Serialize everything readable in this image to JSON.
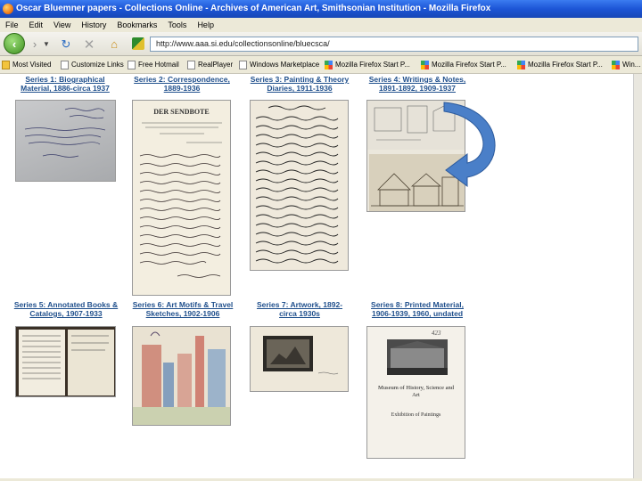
{
  "window": {
    "title": "Oscar Bluemner papers - Collections Online - Archives of American Art, Smithsonian Institution - Mozilla Firefox"
  },
  "menu": [
    "File",
    "Edit",
    "View",
    "History",
    "Bookmarks",
    "Tools",
    "Help"
  ],
  "nav": {
    "url": "http://www.aaa.si.edu/collectionsonline/bluecsca/"
  },
  "bookmarks": [
    "Most Visited",
    "Customize Links",
    "Free Hotmail",
    "RealPlayer",
    "Windows Marketplace",
    "Mozilla Firefox Start P...",
    "Mozilla Firefox Start P...",
    "Mozilla Firefox Start P...",
    "Win..."
  ],
  "series": [
    {
      "title": "Series 1: Biographical Material, 1886-circa 1937"
    },
    {
      "title": "Series 2: Correspondence, 1889-1936"
    },
    {
      "title": "Series 3: Painting & Theory Diaries, 1911-1936"
    },
    {
      "title": "Series 4: Writings & Notes, 1891-1892, 1909-1937"
    },
    {
      "title": "Series 5: Annotated Books & Catalogs, 1907-1933"
    },
    {
      "title": "Series 6: Art Motifs & Travel Sketches, 1902-1906"
    },
    {
      "title": "Series 7: Artwork, 1892-circa 1930s"
    },
    {
      "title": "Series 8: Printed Material, 1906-1939, 1960, undated"
    }
  ],
  "thumbs": {
    "series2_letterhead": "DER SENDBOTE",
    "series8_caption": "Museum of History, Science and Art",
    "series8_sub": "Exhibition of Paintings"
  },
  "colors": {
    "titlebar": "#1c55d6",
    "link": "#1f4f8c",
    "arrow": "#4a7fc8"
  }
}
